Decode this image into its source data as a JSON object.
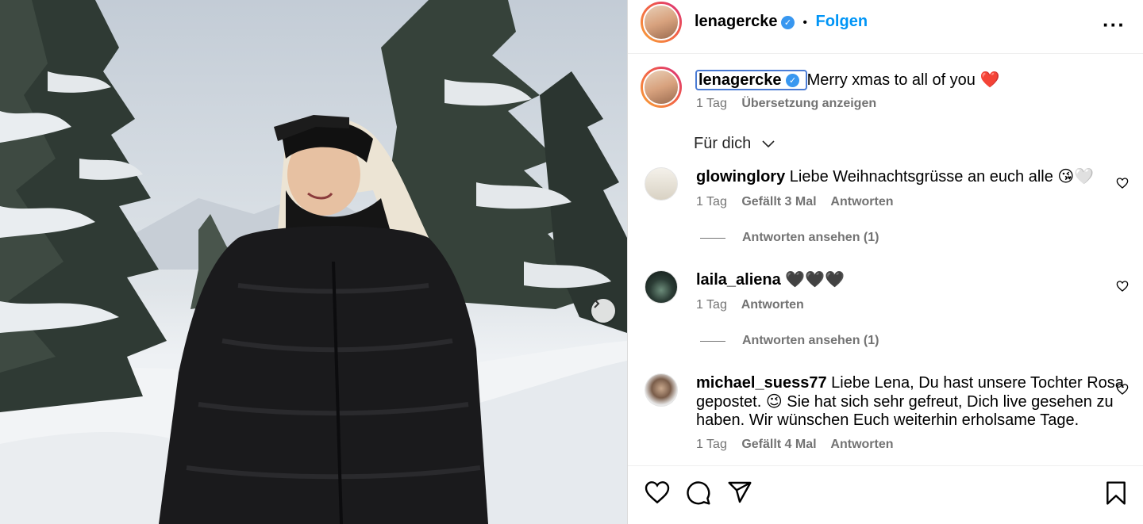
{
  "post": {
    "username": "lenagercke",
    "separator": "•",
    "follow_label": "Folgen",
    "more_label": "···"
  },
  "caption": {
    "username": "lenagercke",
    "text": "Merry xmas to all of you ❤️",
    "time": "1 Tag",
    "translate_label": "Übersetzung anzeigen"
  },
  "filter": {
    "label": "Für dich"
  },
  "comments": [
    {
      "username": "glowinglory",
      "text": "Liebe Weihnachtsgrüsse an euch alle 😘🤍",
      "time": "1 Tag",
      "likes": "Gefällt 3 Mal",
      "reply_label": "Antworten",
      "view_replies": "Antworten ansehen (1)"
    },
    {
      "username": "laila_aliena",
      "text": "🖤🖤🖤",
      "time": "1 Tag",
      "reply_label": "Antworten",
      "view_replies": "Antworten ansehen (1)"
    },
    {
      "username": "michael_suess77",
      "text_line1": "Liebe Lena, Du hast unsere Tochter Rosa",
      "text_line2": "gepostet. 😉 Sie hat sich sehr gefreut, Dich live gesehen zu",
      "text_line3": "haben. Wir wünschen Euch weiterhin erholsame Tage.",
      "time": "1 Tag",
      "likes": "Gefällt 4 Mal",
      "reply_label": "Antworten"
    }
  ],
  "colors": {
    "link_blue": "#0095f6",
    "verified_blue": "#3897f0",
    "meta_gray": "#737373",
    "border": "#dbdbdb"
  },
  "icons": [
    "verified-icon",
    "more-options-icon",
    "chevron-down-icon",
    "like-icon",
    "comment-icon",
    "share-icon",
    "save-icon",
    "next-arrow-icon"
  ]
}
